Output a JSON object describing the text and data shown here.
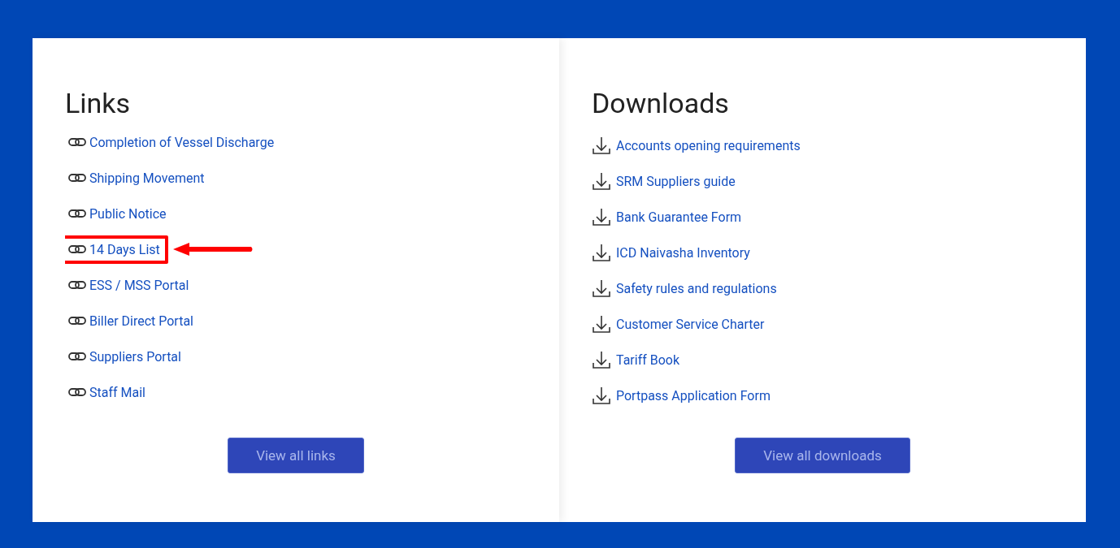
{
  "links": {
    "title": "Links",
    "items": [
      {
        "label": "Completion of Vessel Discharge",
        "highlighted": false
      },
      {
        "label": "Shipping Movement",
        "highlighted": false
      },
      {
        "label": "Public Notice",
        "highlighted": false
      },
      {
        "label": "14 Days List",
        "highlighted": true
      },
      {
        "label": "ESS / MSS Portal",
        "highlighted": false
      },
      {
        "label": "Biller Direct Portal",
        "highlighted": false
      },
      {
        "label": "Suppliers Portal",
        "highlighted": false
      },
      {
        "label": "Staff Mail",
        "highlighted": false
      }
    ],
    "button": "View all links"
  },
  "downloads": {
    "title": "Downloads",
    "items": [
      "Accounts opening requirements",
      "SRM Suppliers guide",
      "Bank Guarantee Form",
      "ICD Naivasha Inventory",
      "Safety rules and regulations",
      "Customer Service Charter",
      "Tariff Book",
      "Portpass Application Form"
    ],
    "button": "View all downloads"
  }
}
